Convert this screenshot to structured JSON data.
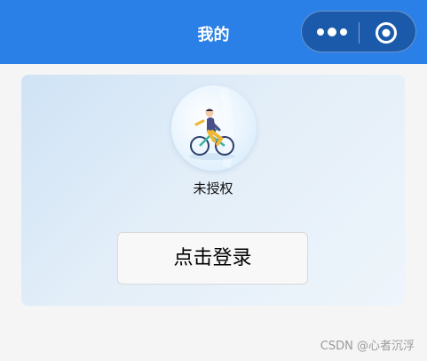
{
  "navbar": {
    "title": "我的",
    "background": "#2a80e6",
    "menu_icon": "more-dots-icon",
    "close_icon": "target-close-icon"
  },
  "profile": {
    "avatar_icon": "cyclist-avatar-icon",
    "status_text": "未授权"
  },
  "login": {
    "button_label": "点击登录"
  },
  "watermark": {
    "text": "CSDN @心者沉浮"
  }
}
